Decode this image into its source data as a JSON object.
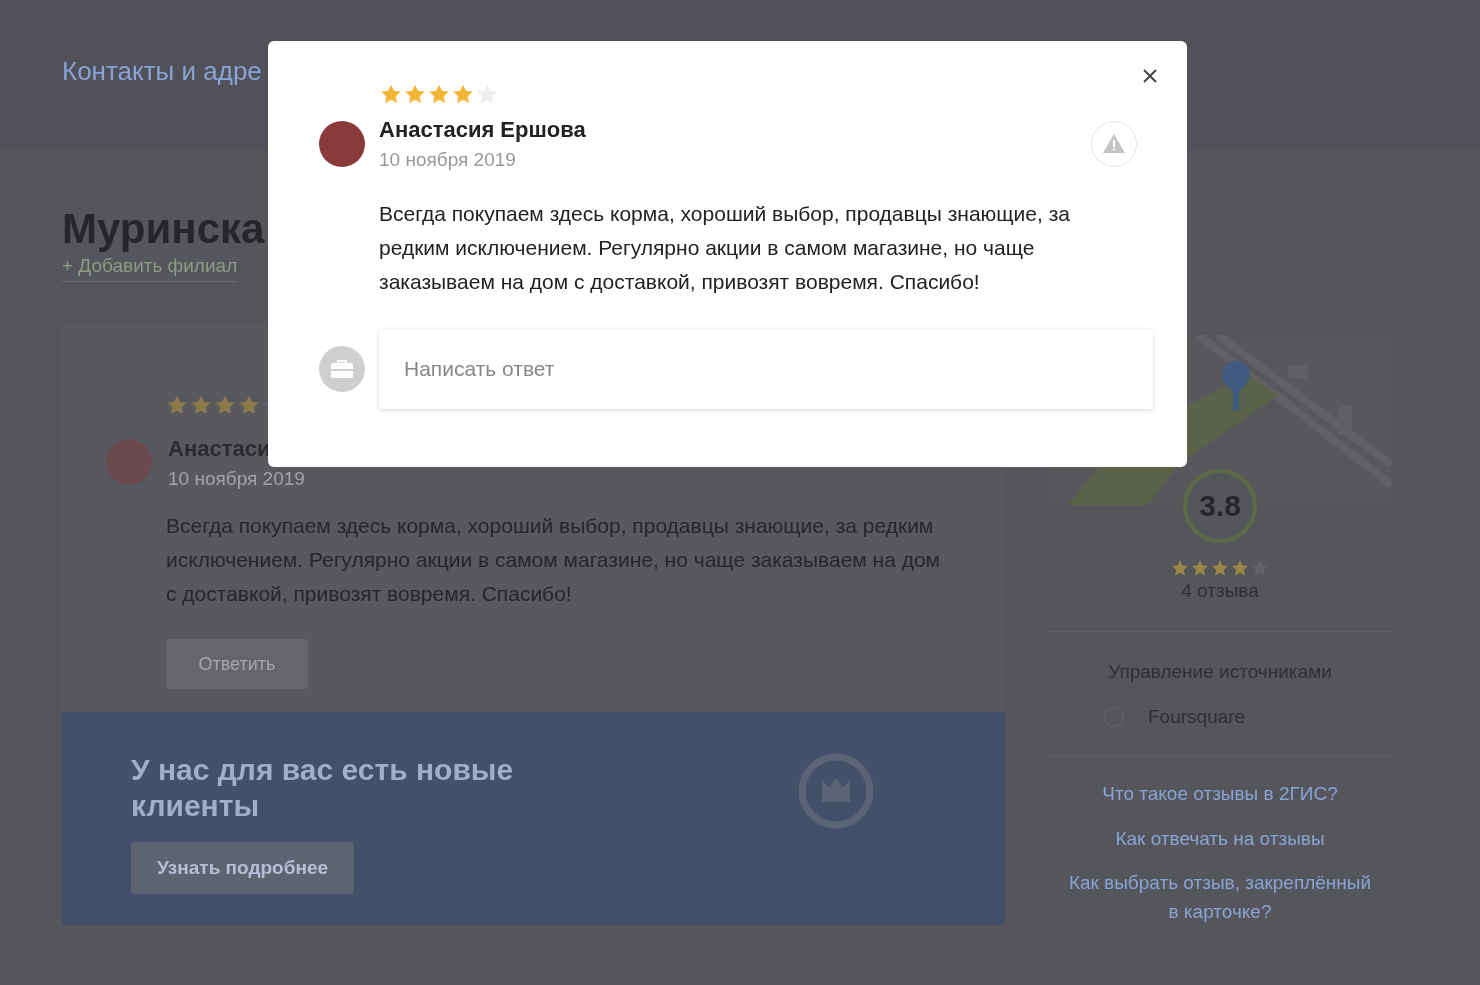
{
  "header": {
    "nav_link": "Контакты и адре"
  },
  "page": {
    "title": "Муринска",
    "add_branch": "+ Добавить филиал"
  },
  "review_card": {
    "stars": 4,
    "author": "Анастаси",
    "date": "10 ноября 2019",
    "text": "Всегда покупаем здесь корма, хороший выбор, продавцы знающие, за редким исключением. Регулярно акции в самом магазине, но чаще заказываем на дом с доставкой, привозят вовремя. Спасибо!",
    "reply_button": "Ответить"
  },
  "promo_banner": {
    "title": "У нас для вас есть новые клиенты",
    "button": "Узнать подробнее"
  },
  "rating_panel": {
    "rating": "3.8",
    "stars": 4,
    "count": "4 отзыва",
    "sources_title": "Управление источниками",
    "sources": [
      {
        "name": "Foursquare"
      }
    ],
    "help_links": [
      "Что такое отзывы в 2ГИС?",
      "Как отвечать на отзывы",
      "Как выбрать отзыв, закреплённый в карточке?"
    ]
  },
  "modal": {
    "stars": 4,
    "author": "Анастасия Ершова",
    "date": "10 ноября 2019",
    "text": "Всегда покупаем здесь корма, хороший выбор, продавцы знающие, за редким исключением. Регулярно акции в самом магазине, но чаще заказываем на дом с доставкой, привозят вовремя. Спасибо!",
    "reply_placeholder": "Написать ответ"
  }
}
